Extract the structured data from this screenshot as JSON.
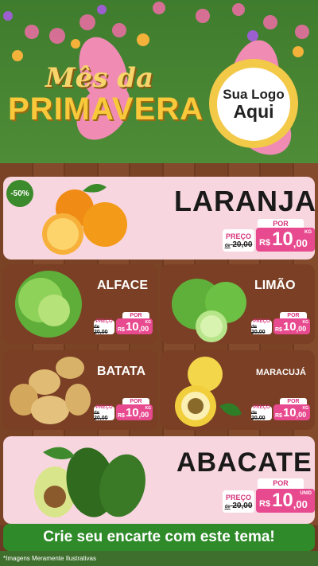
{
  "header": {
    "title_line1": "Mês da",
    "title_line2": "PRIMAVERA",
    "logo_line1": "Sua Logo",
    "logo_line2": "Aqui"
  },
  "products": [
    {
      "name": "LARANJA",
      "badge": "-50%",
      "por": "POR",
      "preco_label": "PREÇO",
      "old_prefix": "de",
      "old_price": "20,00",
      "currency": "R$",
      "new_int": "10",
      "new_dec": ",00",
      "unit": "KG"
    },
    {
      "name": "ALFACE",
      "por": "POR",
      "preco_label": "PREÇO",
      "old_prefix": "de",
      "old_price": "20,00",
      "currency": "R$",
      "new_int": "10",
      "new_dec": ",00",
      "unit": "KG"
    },
    {
      "name": "LIMÃO",
      "por": "POR",
      "preco_label": "PREÇO",
      "old_prefix": "de",
      "old_price": "20,00",
      "currency": "R$",
      "new_int": "10",
      "new_dec": ",00",
      "unit": "KG"
    },
    {
      "name": "BATATA",
      "por": "POR",
      "preco_label": "PREÇO",
      "old_prefix": "de",
      "old_price": "20,00",
      "currency": "R$",
      "new_int": "10",
      "new_dec": ",00",
      "unit": "KG"
    },
    {
      "name": "MARACUJÁ",
      "por": "POR",
      "preco_label": "PREÇO",
      "old_prefix": "de",
      "old_price": "20,00",
      "currency": "R$",
      "new_int": "10",
      "new_dec": ",00",
      "unit": "KG"
    },
    {
      "name": "ABACATE",
      "por": "POR",
      "preco_label": "PREÇO",
      "old_prefix": "de",
      "old_price": "20,00",
      "currency": "R$",
      "new_int": "10",
      "new_dec": ",00",
      "unit": "UNID"
    }
  ],
  "cta": "Crie seu encarte com este tema!",
  "footnote": "*Imagens Meramente Ilustrativas",
  "colors": {
    "accent": "#e84a8f",
    "green": "#2f8b2a",
    "wood": "#7b4326",
    "card": "#f7d6e0"
  }
}
